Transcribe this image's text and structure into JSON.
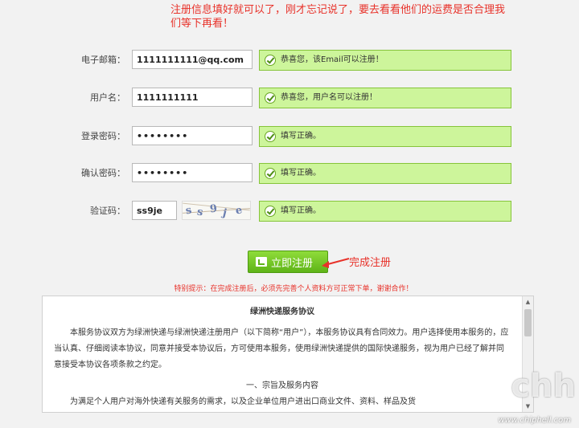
{
  "annotation_top": "注册信息填好就可以了，刚才忘记说了，要去看看他们的运费是否合理我们等下再看！",
  "form": {
    "email": {
      "label": "电子邮箱：",
      "value": "1111111111@qq.com",
      "hint": "恭喜您，该Email可以注册！"
    },
    "username": {
      "label": "用户名：",
      "value": "1111111111",
      "hint": "恭喜您，用户名可以注册！"
    },
    "password": {
      "label": "登录密码：",
      "value": "••••••••",
      "hint": "填写正确。"
    },
    "confirm_password": {
      "label": "确认密码：",
      "value": "••••••••",
      "hint": "填写正确。"
    },
    "captcha": {
      "label": "验证码：",
      "value": "ss9je",
      "image_text": "ss9je",
      "hint": "填写正确。"
    }
  },
  "submit": {
    "label": "立即注册"
  },
  "annotation_submit": "完成注册",
  "tip": "特别提示：在完成注册后，必须先完善个人资料方可正常下单，谢谢合作！",
  "agreement": {
    "title": "绿洲快递服务协议",
    "paragraph": "本服务协议双方为绿洲快递与绿洲快递注册用户（以下简称“用户”），本服务协议具有合同效力。用户选择使用本服务的，应当认真、仔细阅读本协议，同意并接受本协议后，方可使用本服务，使用绿洲快递提供的国际快递服务，视为用户已经了解并同意接受本协议各项条款之约定。",
    "section_title": "一、宗旨及服务内容",
    "section_text": "为满足个人用户对海外快递有关服务的需求，以及企业单位用户进出口商业文件、资料、样品及货"
  },
  "watermark": {
    "logo": "chiphell",
    "url": "www.chiphell.com"
  },
  "colors": {
    "hint_bg": "#cdf59b",
    "hint_border": "#86c43a",
    "button": "#6cc021",
    "annotation": "#e8322a"
  }
}
